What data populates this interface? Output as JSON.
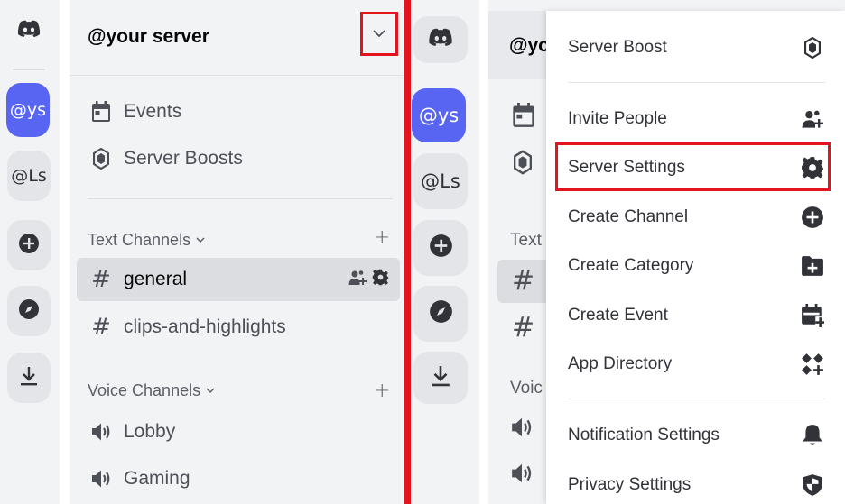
{
  "server": {
    "name": "@your server",
    "name_truncated": "@yo"
  },
  "rail": {
    "items": [
      {
        "label": "",
        "icon": "discord-logo-icon"
      },
      {
        "label": "@ys",
        "active": true
      },
      {
        "label": "@Ls"
      },
      {
        "label": "",
        "icon": "add-server-icon"
      },
      {
        "label": "",
        "icon": "explore-icon"
      },
      {
        "label": "",
        "icon": "download-icon"
      }
    ]
  },
  "sidebar": {
    "events_label": "Events",
    "boosts_label": "Server Boosts",
    "text_category": "Text Channels",
    "text_category_truncated": "Text",
    "voice_category": "Voice Channels",
    "voice_category_truncated": "Voic",
    "text_channels": [
      "general",
      "clips-and-highlights"
    ],
    "voice_channels": [
      "Lobby",
      "Gaming"
    ],
    "hash_symbol": "#"
  },
  "menu": {
    "items": [
      {
        "label": "Server Boost",
        "icon": "boost-icon"
      },
      {
        "label": "Invite People",
        "icon": "invite-people-icon"
      },
      {
        "label": "Server Settings",
        "icon": "gear-icon",
        "highlighted": true
      },
      {
        "label": "Create Channel",
        "icon": "plus-circle-icon"
      },
      {
        "label": "Create Category",
        "icon": "folder-plus-icon"
      },
      {
        "label": "Create Event",
        "icon": "calendar-plus-icon"
      },
      {
        "label": "App Directory",
        "icon": "apps-icon"
      },
      {
        "label": "Notification Settings",
        "icon": "bell-icon"
      },
      {
        "label": "Privacy Settings",
        "icon": "shield-icon"
      }
    ]
  },
  "colors": {
    "accent": "#5865f2",
    "highlight_border": "#e5131d",
    "sidebar_bg": "#f2f3f5"
  }
}
